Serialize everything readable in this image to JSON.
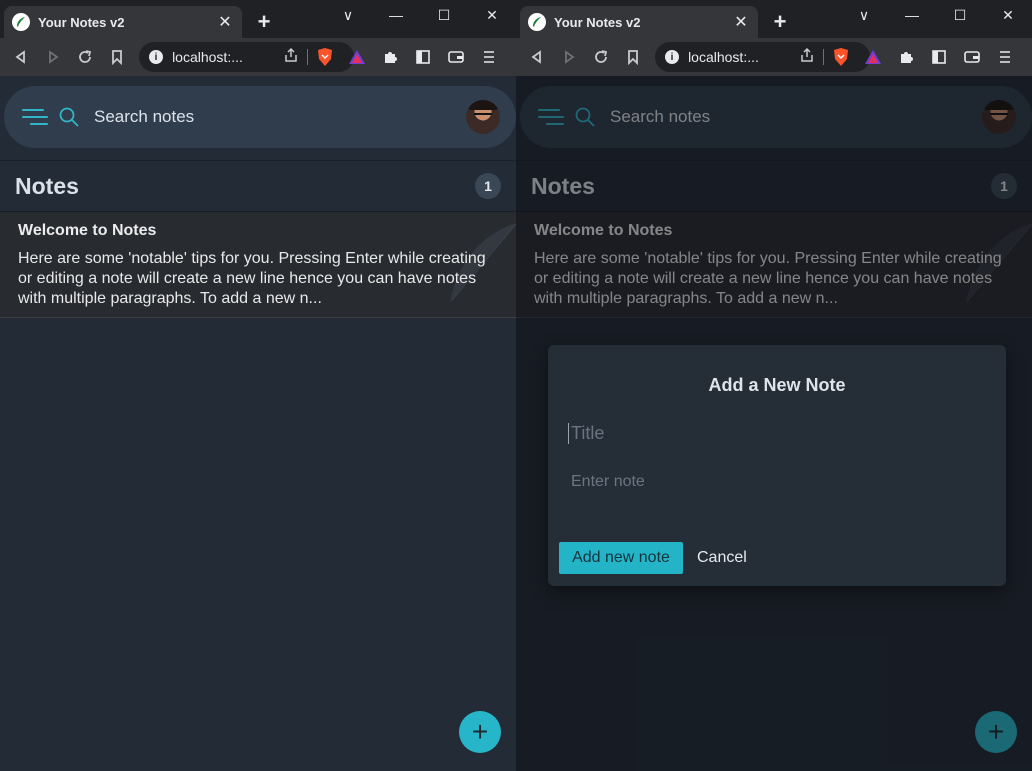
{
  "browser": {
    "tab_title": "Your Notes v2",
    "url": "localhost:...",
    "new_tab_symbol": "+",
    "close_tab_symbol": "✕",
    "window_controls": [
      "∨",
      "—",
      "☐",
      "✕"
    ]
  },
  "app": {
    "search_placeholder": "Search notes",
    "header_title": "Notes",
    "note_count": "1",
    "notes": [
      {
        "title": "Welcome to Notes",
        "body": "Here are some 'notable' tips for you. Pressing Enter while creating or editing a note will create a new line hence you can have notes with multiple paragraphs. To add a new n..."
      }
    ],
    "fab_symbol": "+"
  },
  "modal": {
    "heading": "Add a New Note",
    "title_placeholder": "Title",
    "note_placeholder": "Enter note",
    "add_label": "Add new note",
    "cancel_label": "Cancel"
  },
  "colors": {
    "accent": "#27b6c9",
    "app_bg": "#222b36",
    "searchbar_bg": "#2f3d4c",
    "note_bg": "#282b30"
  }
}
